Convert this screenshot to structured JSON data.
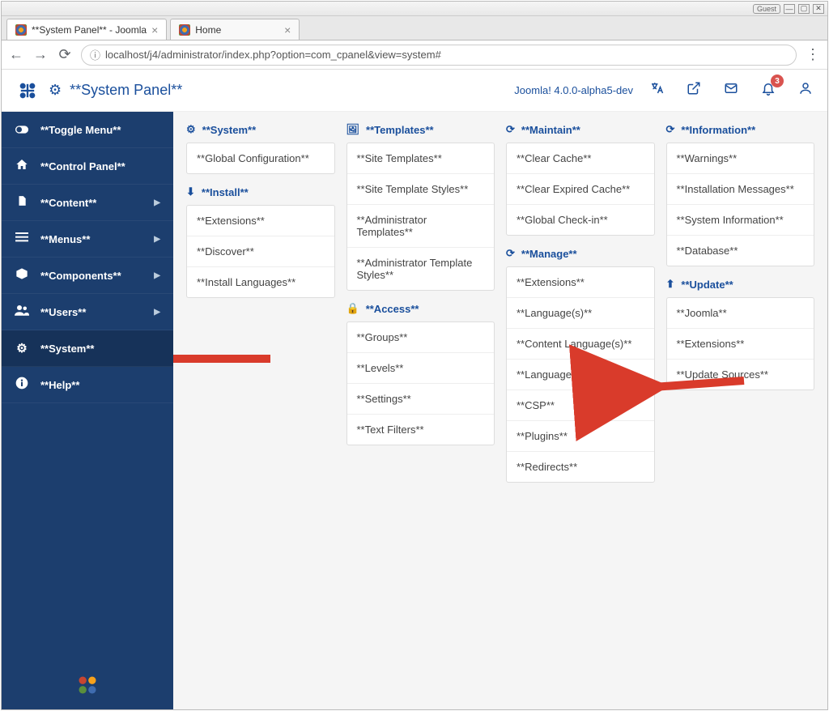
{
  "window": {
    "guest_badge": "Guest",
    "tabs": [
      {
        "title": "**System Panel** - Joomla"
      },
      {
        "title": "Home"
      }
    ],
    "url": "localhost/j4/administrator/index.php?option=com_cpanel&view=system#"
  },
  "topbar": {
    "title": "**System Panel**",
    "version": "Joomla! 4.0.0-alpha5-dev",
    "notification_count": "3"
  },
  "sidebar": {
    "items": [
      {
        "label": "**Toggle Menu**"
      },
      {
        "label": "**Control Panel**"
      },
      {
        "label": "**Content**"
      },
      {
        "label": "**Menus**"
      },
      {
        "label": "**Components**"
      },
      {
        "label": "**Users**"
      },
      {
        "label": "**System**"
      },
      {
        "label": "**Help**"
      }
    ]
  },
  "panels": {
    "col1": [
      {
        "title": "**System**",
        "items": [
          "**Global Configuration**"
        ]
      },
      {
        "title": "**Install**",
        "items": [
          "**Extensions**",
          "**Discover**",
          "**Install Languages**"
        ]
      }
    ],
    "col2": [
      {
        "title": "**Templates**",
        "items": [
          "**Site Templates**",
          "**Site Template Styles**",
          "**Administrator Templates**",
          "**Administrator Template Styles**"
        ]
      },
      {
        "title": "**Access**",
        "items": [
          "**Groups**",
          "**Levels**",
          "**Settings**",
          "**Text Filters**"
        ]
      }
    ],
    "col3": [
      {
        "title": "**Maintain**",
        "items": [
          "**Clear Cache**",
          "**Clear Expired Cache**",
          "**Global Check-in**"
        ]
      },
      {
        "title": "**Manage**",
        "items": [
          "**Extensions**",
          "**Language(s)**",
          "**Content Language(s)**",
          "**Language Overrides**",
          "**CSP**",
          "**Plugins**",
          "**Redirects**"
        ]
      }
    ],
    "col4": [
      {
        "title": "**Information**",
        "items": [
          "**Warnings**",
          "**Installation Messages**",
          "**System Information**",
          "**Database**"
        ]
      },
      {
        "title": "**Update**",
        "items": [
          "**Joomla**",
          "**Extensions**",
          "**Update Sources**"
        ]
      }
    ]
  }
}
